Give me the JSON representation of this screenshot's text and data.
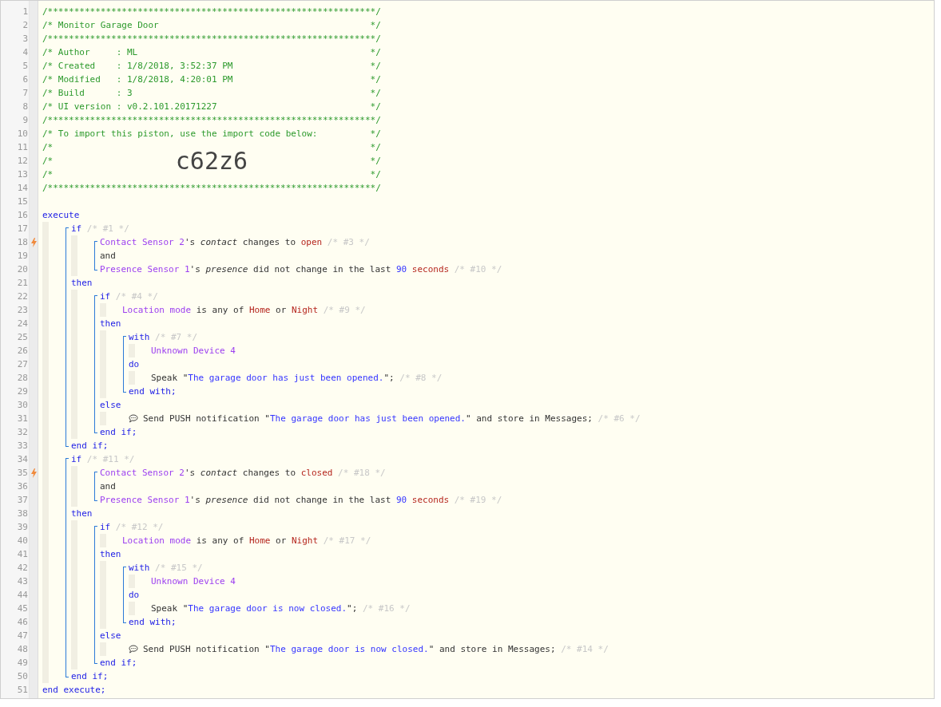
{
  "header": [
    {
      "number": "1",
      "trigger": false,
      "tokens": [
        {
          "kind": "comment",
          "text": "/**************************************************************/"
        }
      ]
    },
    {
      "number": "2",
      "trigger": false,
      "tokens": [
        {
          "kind": "comment",
          "text": "/* Monitor Garage Door"
        },
        {
          "kind": "comment-end",
          "text": "*/"
        }
      ]
    },
    {
      "number": "3",
      "trigger": false,
      "tokens": [
        {
          "kind": "comment",
          "text": "/**************************************************************/"
        }
      ]
    },
    {
      "number": "4",
      "trigger": false,
      "tokens": [
        {
          "kind": "comment",
          "text": "/* Author     : ML"
        },
        {
          "kind": "comment-end",
          "text": "*/"
        }
      ]
    },
    {
      "number": "5",
      "trigger": false,
      "tokens": [
        {
          "kind": "comment",
          "text": "/* Created    : 1/8/2018, 3:52:37 PM"
        },
        {
          "kind": "comment-end",
          "text": "*/"
        }
      ]
    },
    {
      "number": "6",
      "trigger": false,
      "tokens": [
        {
          "kind": "comment",
          "text": "/* Modified   : 1/8/2018, 4:20:01 PM"
        },
        {
          "kind": "comment-end",
          "text": "*/"
        }
      ]
    },
    {
      "number": "7",
      "trigger": false,
      "tokens": [
        {
          "kind": "comment",
          "text": "/* Build      : 3"
        },
        {
          "kind": "comment-end",
          "text": "*/"
        }
      ]
    },
    {
      "number": "8",
      "trigger": false,
      "tokens": [
        {
          "kind": "comment",
          "text": "/* UI version : v0.2.101.20171227"
        },
        {
          "kind": "comment-end",
          "text": "*/"
        }
      ]
    },
    {
      "number": "9",
      "trigger": false,
      "tokens": [
        {
          "kind": "comment",
          "text": "/**************************************************************/"
        }
      ]
    },
    {
      "number": "10",
      "trigger": false,
      "tokens": [
        {
          "kind": "comment",
          "text": "/* To import this piston, use the import code below:"
        },
        {
          "kind": "comment-end",
          "text": "*/"
        }
      ]
    },
    {
      "number": "11",
      "trigger": false,
      "tokens": [
        {
          "kind": "comment",
          "text": "/*"
        },
        {
          "kind": "comment-end",
          "text": "*/"
        }
      ]
    },
    {
      "number": "12",
      "trigger": false,
      "tokens": [
        {
          "kind": "comment",
          "text": "/*"
        },
        {
          "kind": "import-code",
          "text": "c62z6"
        },
        {
          "kind": "comment",
          "text": "*/"
        }
      ]
    },
    {
      "number": "13",
      "trigger": false,
      "tokens": [
        {
          "kind": "comment",
          "text": "/*"
        },
        {
          "kind": "comment-end",
          "text": "*/"
        }
      ]
    },
    {
      "number": "14",
      "trigger": false,
      "tokens": [
        {
          "kind": "comment",
          "text": "/**************************************************************/"
        }
      ]
    },
    {
      "number": "15",
      "trigger": false
    }
  ],
  "body": [
    {
      "kind": "code",
      "number": "16",
      "trigger": false,
      "tokens": [
        {
          "kind": "keyword",
          "text": "execute"
        }
      ],
      "children": [
        {
          "kind": "bracket",
          "children": [
            {
              "kind": "code",
              "number": "17",
              "trigger": false,
              "tokens": [
                {
                  "kind": "keyword",
                  "text": "if"
                },
                {
                  "kind": "note",
                  "text": " /* #1 */"
                }
              ],
              "children": [
                {
                  "kind": "bracket",
                  "children": [
                    {
                      "kind": "code",
                      "number": "18",
                      "trigger": true,
                      "tokens": [
                        {
                          "kind": "device",
                          "text": "Contact Sensor 2"
                        },
                        {
                          "kind": "plain",
                          "text": "'s "
                        },
                        {
                          "kind": "attribute",
                          "text": "contact"
                        },
                        {
                          "kind": "plain",
                          "text": " changes to "
                        },
                        {
                          "kind": "value",
                          "text": "open"
                        },
                        {
                          "kind": "note",
                          "text": " /* #3 */"
                        }
                      ]
                    },
                    {
                      "kind": "code",
                      "number": "19",
                      "trigger": false,
                      "tokens": [
                        {
                          "kind": "plain",
                          "text": "and"
                        }
                      ]
                    },
                    {
                      "kind": "code",
                      "number": "20",
                      "trigger": false,
                      "tokens": [
                        {
                          "kind": "device",
                          "text": "Presence Sensor 1"
                        },
                        {
                          "kind": "plain",
                          "text": "'s "
                        },
                        {
                          "kind": "attribute",
                          "text": "presence"
                        },
                        {
                          "kind": "plain",
                          "text": " did not change in the last "
                        },
                        {
                          "kind": "number",
                          "text": "90"
                        },
                        {
                          "kind": "value",
                          "text": " seconds"
                        },
                        {
                          "kind": "note",
                          "text": " /* #10 */"
                        }
                      ]
                    }
                  ]
                }
              ]
            },
            {
              "kind": "code",
              "number": "21",
              "trigger": false,
              "tokens": [
                {
                  "kind": "keyword",
                  "text": "then"
                }
              ],
              "children": [
                {
                  "kind": "bracket",
                  "children": [
                    {
                      "kind": "code",
                      "number": "22",
                      "trigger": false,
                      "tokens": [
                        {
                          "kind": "keyword",
                          "text": "if"
                        },
                        {
                          "kind": "note",
                          "text": " /* #4 */"
                        }
                      ],
                      "children": [
                        {
                          "kind": "code",
                          "number": "23",
                          "trigger": false,
                          "tokens": [
                            {
                              "kind": "device",
                              "text": "Location mode"
                            },
                            {
                              "kind": "plain",
                              "text": " is any of "
                            },
                            {
                              "kind": "value",
                              "text": "Home"
                            },
                            {
                              "kind": "plain",
                              "text": " or "
                            },
                            {
                              "kind": "value",
                              "text": "Night"
                            },
                            {
                              "kind": "note",
                              "text": " /* #9 */"
                            }
                          ]
                        }
                      ]
                    },
                    {
                      "kind": "code",
                      "number": "24",
                      "trigger": false,
                      "tokens": [
                        {
                          "kind": "keyword",
                          "text": "then"
                        }
                      ],
                      "children": [
                        {
                          "kind": "bracket",
                          "children": [
                            {
                              "kind": "code",
                              "number": "25",
                              "trigger": false,
                              "tokens": [
                                {
                                  "kind": "keyword",
                                  "text": "with"
                                },
                                {
                                  "kind": "note",
                                  "text": " /* #7 */"
                                }
                              ],
                              "children": [
                                {
                                  "kind": "code",
                                  "number": "26",
                                  "trigger": false,
                                  "tokens": [
                                    {
                                      "kind": "device",
                                      "text": "Unknown Device 4"
                                    }
                                  ]
                                }
                              ]
                            },
                            {
                              "kind": "code",
                              "number": "27",
                              "trigger": false,
                              "tokens": [
                                {
                                  "kind": "keyword",
                                  "text": "do"
                                }
                              ],
                              "children": [
                                {
                                  "kind": "code",
                                  "number": "28",
                                  "trigger": false,
                                  "tokens": [
                                    {
                                      "kind": "plain",
                                      "text": "Speak \""
                                    },
                                    {
                                      "kind": "string",
                                      "text": "The garage door has just been opened."
                                    },
                                    {
                                      "kind": "plain",
                                      "text": "\"; "
                                    },
                                    {
                                      "kind": "note",
                                      "text": "/* #8 */"
                                    }
                                  ]
                                }
                              ]
                            },
                            {
                              "kind": "code",
                              "number": "29",
                              "trigger": false,
                              "tokens": [
                                {
                                  "kind": "keyword",
                                  "text": "end with;"
                                }
                              ]
                            }
                          ]
                        }
                      ]
                    },
                    {
                      "kind": "code",
                      "number": "30",
                      "trigger": false,
                      "tokens": [
                        {
                          "kind": "keyword",
                          "text": "else"
                        }
                      ],
                      "children": [
                        {
                          "kind": "notify",
                          "number": "31",
                          "trigger": false,
                          "tokens": [
                            {
                              "kind": "plain",
                              "text": "Send PUSH notification \""
                            },
                            {
                              "kind": "string",
                              "text": "The garage door has just been opened."
                            },
                            {
                              "kind": "plain",
                              "text": "\" and store in Messages; "
                            },
                            {
                              "kind": "note",
                              "text": "/* #6 */"
                            }
                          ]
                        }
                      ]
                    },
                    {
                      "kind": "code",
                      "number": "32",
                      "trigger": false,
                      "tokens": [
                        {
                          "kind": "keyword",
                          "text": "end if;"
                        }
                      ]
                    }
                  ]
                }
              ]
            },
            {
              "kind": "code",
              "number": "33",
              "trigger": false,
              "tokens": [
                {
                  "kind": "keyword",
                  "text": "end if;"
                }
              ]
            }
          ]
        },
        {
          "kind": "bracket",
          "children": [
            {
              "kind": "code",
              "number": "34",
              "trigger": false,
              "tokens": [
                {
                  "kind": "keyword",
                  "text": "if"
                },
                {
                  "kind": "note",
                  "text": " /* #11 */"
                }
              ],
              "children": [
                {
                  "kind": "bracket",
                  "children": [
                    {
                      "kind": "code",
                      "number": "35",
                      "trigger": true,
                      "tokens": [
                        {
                          "kind": "device",
                          "text": "Contact Sensor 2"
                        },
                        {
                          "kind": "plain",
                          "text": "'s "
                        },
                        {
                          "kind": "attribute",
                          "text": "contact"
                        },
                        {
                          "kind": "plain",
                          "text": " changes to "
                        },
                        {
                          "kind": "value",
                          "text": "closed"
                        },
                        {
                          "kind": "note",
                          "text": " /* #18 */"
                        }
                      ]
                    },
                    {
                      "kind": "code",
                      "number": "36",
                      "trigger": false,
                      "tokens": [
                        {
                          "kind": "plain",
                          "text": "and"
                        }
                      ]
                    },
                    {
                      "kind": "code",
                      "number": "37",
                      "trigger": false,
                      "tokens": [
                        {
                          "kind": "device",
                          "text": "Presence Sensor 1"
                        },
                        {
                          "kind": "plain",
                          "text": "'s "
                        },
                        {
                          "kind": "attribute",
                          "text": "presence"
                        },
                        {
                          "kind": "plain",
                          "text": " did not change in the last "
                        },
                        {
                          "kind": "number",
                          "text": "90"
                        },
                        {
                          "kind": "value",
                          "text": " seconds"
                        },
                        {
                          "kind": "note",
                          "text": " /* #19 */"
                        }
                      ]
                    }
                  ]
                }
              ]
            },
            {
              "kind": "code",
              "number": "38",
              "trigger": false,
              "tokens": [
                {
                  "kind": "keyword",
                  "text": "then"
                }
              ],
              "children": [
                {
                  "kind": "bracket",
                  "children": [
                    {
                      "kind": "code",
                      "number": "39",
                      "trigger": false,
                      "tokens": [
                        {
                          "kind": "keyword",
                          "text": "if"
                        },
                        {
                          "kind": "note",
                          "text": " /* #12 */"
                        }
                      ],
                      "children": [
                        {
                          "kind": "code",
                          "number": "40",
                          "trigger": false,
                          "tokens": [
                            {
                              "kind": "device",
                              "text": "Location mode"
                            },
                            {
                              "kind": "plain",
                              "text": " is any of "
                            },
                            {
                              "kind": "value",
                              "text": "Home"
                            },
                            {
                              "kind": "plain",
                              "text": " or "
                            },
                            {
                              "kind": "value",
                              "text": "Night"
                            },
                            {
                              "kind": "note",
                              "text": " /* #17 */"
                            }
                          ]
                        }
                      ]
                    },
                    {
                      "kind": "code",
                      "number": "41",
                      "trigger": false,
                      "tokens": [
                        {
                          "kind": "keyword",
                          "text": "then"
                        }
                      ],
                      "children": [
                        {
                          "kind": "bracket",
                          "children": [
                            {
                              "kind": "code",
                              "number": "42",
                              "trigger": false,
                              "tokens": [
                                {
                                  "kind": "keyword",
                                  "text": "with"
                                },
                                {
                                  "kind": "note",
                                  "text": " /* #15 */"
                                }
                              ],
                              "children": [
                                {
                                  "kind": "code",
                                  "number": "43",
                                  "trigger": false,
                                  "tokens": [
                                    {
                                      "kind": "device",
                                      "text": "Unknown Device 4"
                                    }
                                  ]
                                }
                              ]
                            },
                            {
                              "kind": "code",
                              "number": "44",
                              "trigger": false,
                              "tokens": [
                                {
                                  "kind": "keyword",
                                  "text": "do"
                                }
                              ],
                              "children": [
                                {
                                  "kind": "code",
                                  "number": "45",
                                  "trigger": false,
                                  "tokens": [
                                    {
                                      "kind": "plain",
                                      "text": "Speak \""
                                    },
                                    {
                                      "kind": "string",
                                      "text": "The garage door is now closed."
                                    },
                                    {
                                      "kind": "plain",
                                      "text": "\"; "
                                    },
                                    {
                                      "kind": "note",
                                      "text": "/* #16 */"
                                    }
                                  ]
                                }
                              ]
                            },
                            {
                              "kind": "code",
                              "number": "46",
                              "trigger": false,
                              "tokens": [
                                {
                                  "kind": "keyword",
                                  "text": "end with;"
                                }
                              ]
                            }
                          ]
                        }
                      ]
                    },
                    {
                      "kind": "code",
                      "number": "47",
                      "trigger": false,
                      "tokens": [
                        {
                          "kind": "keyword",
                          "text": "else"
                        }
                      ],
                      "children": [
                        {
                          "kind": "notify",
                          "number": "48",
                          "trigger": false,
                          "tokens": [
                            {
                              "kind": "plain",
                              "text": "Send PUSH notification \""
                            },
                            {
                              "kind": "string",
                              "text": "The garage door is now closed."
                            },
                            {
                              "kind": "plain",
                              "text": "\" and store in Messages; "
                            },
                            {
                              "kind": "note",
                              "text": "/* #14 */"
                            }
                          ]
                        }
                      ]
                    },
                    {
                      "kind": "code",
                      "number": "49",
                      "trigger": false,
                      "tokens": [
                        {
                          "kind": "keyword",
                          "text": "end if;"
                        }
                      ]
                    }
                  ]
                }
              ]
            },
            {
              "kind": "code",
              "number": "50",
              "trigger": false,
              "tokens": [
                {
                  "kind": "keyword",
                  "text": "end if;"
                }
              ]
            }
          ]
        }
      ]
    },
    {
      "kind": "code",
      "number": "51",
      "trigger": false,
      "tokens": [
        {
          "kind": "keyword",
          "text": "end execute;"
        }
      ]
    }
  ]
}
